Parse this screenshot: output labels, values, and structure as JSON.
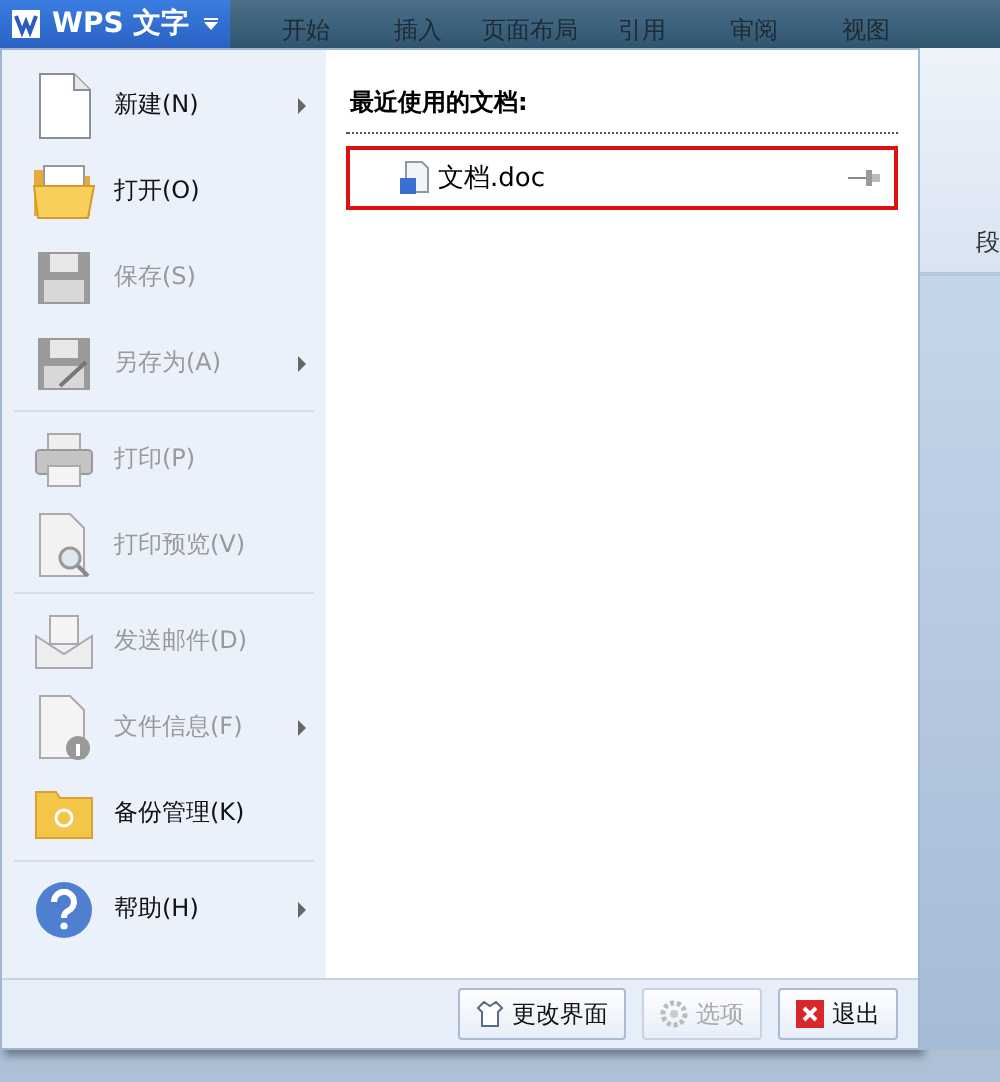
{
  "app_button": {
    "label": "WPS 文字"
  },
  "tabs": [
    {
      "label": "开始",
      "selected": false
    },
    {
      "label": "插入",
      "selected": false
    },
    {
      "label": "页面布局",
      "selected": false
    },
    {
      "label": "引用",
      "selected": false
    },
    {
      "label": "审阅",
      "selected": false
    },
    {
      "label": "视图",
      "selected": false
    }
  ],
  "menu": {
    "groups": [
      [
        {
          "label": "新建(N)",
          "disabled": false,
          "submenu": true
        },
        {
          "label": "打开(O)",
          "disabled": false,
          "submenu": false
        },
        {
          "label": "保存(S)",
          "disabled": true,
          "submenu": false
        },
        {
          "label": "另存为(A)",
          "disabled": true,
          "submenu": true
        }
      ],
      [
        {
          "label": "打印(P)",
          "disabled": true,
          "submenu": false
        },
        {
          "label": "打印预览(V)",
          "disabled": true,
          "submenu": false
        }
      ],
      [
        {
          "label": "发送邮件(D)",
          "disabled": true,
          "submenu": false
        },
        {
          "label": "文件信息(F)",
          "disabled": true,
          "submenu": true
        },
        {
          "label": "备份管理(K)",
          "disabled": false,
          "submenu": false
        }
      ],
      [
        {
          "label": "帮助(H)",
          "disabled": false,
          "submenu": true
        }
      ]
    ]
  },
  "recent": {
    "heading": "最近使用的文档:",
    "items": [
      {
        "name": "文档.doc",
        "highlighted": true
      }
    ]
  },
  "footer_buttons": [
    {
      "label": "更改界面",
      "disabled": false
    },
    {
      "label": "选项",
      "disabled": true
    },
    {
      "label": "退出",
      "disabled": false
    }
  ],
  "ribbon": {
    "group_label": "段"
  }
}
